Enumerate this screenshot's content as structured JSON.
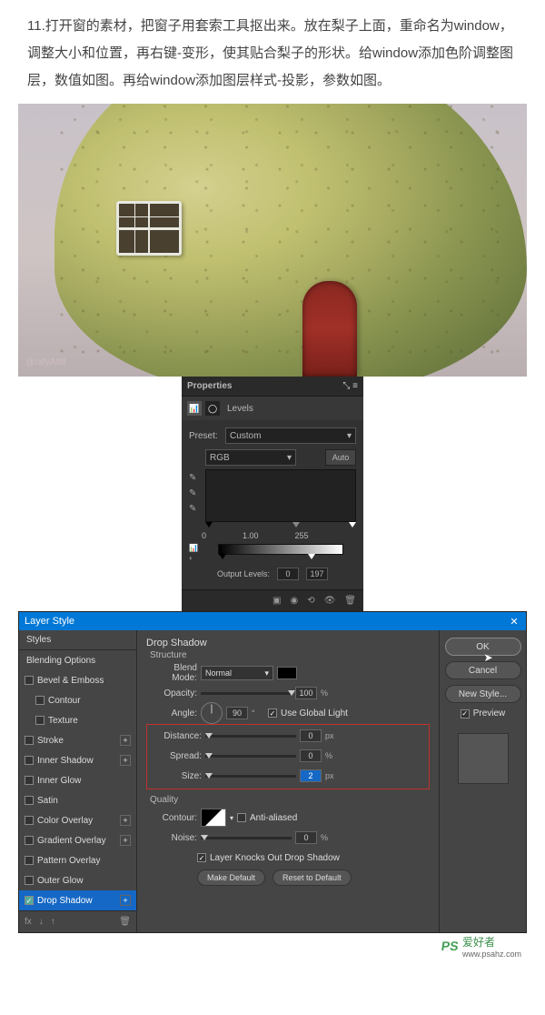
{
  "article": {
    "text": "11.打开窗的素材，把窗子用套索工具抠出来。放在梨子上面，重命名为window，调整大小和位置，再右键-变形，使其贴合梨子的形状。给window添加色阶调整图层，数值如图。再给window添加图层样式-投影，参数如图。"
  },
  "image_watermark": "@rafyA88",
  "properties": {
    "title": "Properties",
    "type_label": "Levels",
    "preset_label": "Preset:",
    "preset_value": "Custom",
    "channel": "RGB",
    "auto_btn": "Auto",
    "input_levels": {
      "black": "0",
      "mid": "1.00",
      "white": "255"
    },
    "output_label": "Output Levels:",
    "output_levels": {
      "black": "0",
      "white": "197"
    }
  },
  "layer_style": {
    "title": "Layer Style",
    "left": {
      "styles": "Styles",
      "blending": "Blending Options",
      "bevel": "Bevel & Emboss",
      "contour": "Contour",
      "texture": "Texture",
      "stroke": "Stroke",
      "inner_shadow": "Inner Shadow",
      "inner_glow": "Inner Glow",
      "satin": "Satin",
      "color_overlay": "Color Overlay",
      "gradient_overlay": "Gradient Overlay",
      "pattern_overlay": "Pattern Overlay",
      "outer_glow": "Outer Glow",
      "drop_shadow": "Drop Shadow",
      "fx": "fx"
    },
    "center": {
      "section": "Drop Shadow",
      "structure": "Structure",
      "blend_mode_label": "Blend Mode:",
      "blend_mode_value": "Normal",
      "opacity_label": "Opacity:",
      "opacity_value": "100",
      "angle_label": "Angle:",
      "angle_value": "90",
      "global_light": "Use Global Light",
      "distance_label": "Distance:",
      "distance_value": "0",
      "spread_label": "Spread:",
      "spread_value": "0",
      "size_label": "Size:",
      "size_value": "2",
      "quality": "Quality",
      "contour_label": "Contour:",
      "antialiased": "Anti-aliased",
      "noise_label": "Noise:",
      "noise_value": "0",
      "knockout": "Layer Knocks Out Drop Shadow",
      "make_default": "Make Default",
      "reset_default": "Reset to Default",
      "px": "px",
      "pct": "%",
      "deg": "°"
    },
    "right": {
      "ok": "OK",
      "cancel": "Cancel",
      "new_style": "New Style...",
      "preview": "Preview"
    }
  },
  "watermark": {
    "logo": "PS",
    "text": "爱好者",
    "url": "www.psahz.com"
  }
}
